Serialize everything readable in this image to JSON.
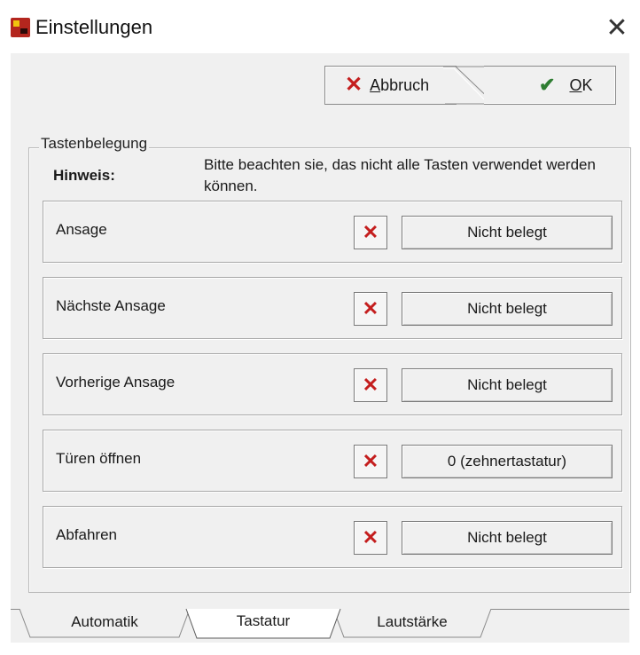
{
  "window": {
    "title": "Einstellungen",
    "close_glyph": "✕"
  },
  "toolbar": {
    "cancel_label_pre": "",
    "cancel_mnemonic": "A",
    "cancel_label_post": "bbruch",
    "ok_mnemonic": "O",
    "ok_label_post": "K"
  },
  "group": {
    "title": "Tastenbelegung",
    "hint_label": "Hinweis:",
    "hint_text": "Bitte beachten sie, das nicht alle Tasten verwendet werden können."
  },
  "bindings": [
    {
      "label": "Ansage",
      "key": "Nicht belegt"
    },
    {
      "label": "Nächste Ansage",
      "key": "Nicht belegt"
    },
    {
      "label": "Vorherige Ansage",
      "key": "Nicht belegt"
    },
    {
      "label": "Türen öffnen",
      "key": "0 (zehnertastatur)"
    },
    {
      "label": "Abfahren",
      "key": "Nicht belegt"
    }
  ],
  "tabs": [
    {
      "label": "Automatik",
      "active": false
    },
    {
      "label": "Tastatur",
      "active": true
    },
    {
      "label": "Lautstärke",
      "active": false
    }
  ],
  "icons": {
    "cancel": "x-icon",
    "ok": "checkmark-icon",
    "clear": "x-icon",
    "app": "app-icon"
  },
  "colors": {
    "cancel_x": "#c41e1e",
    "ok_check": "#2e7d32",
    "background": "#f0f0f0"
  }
}
